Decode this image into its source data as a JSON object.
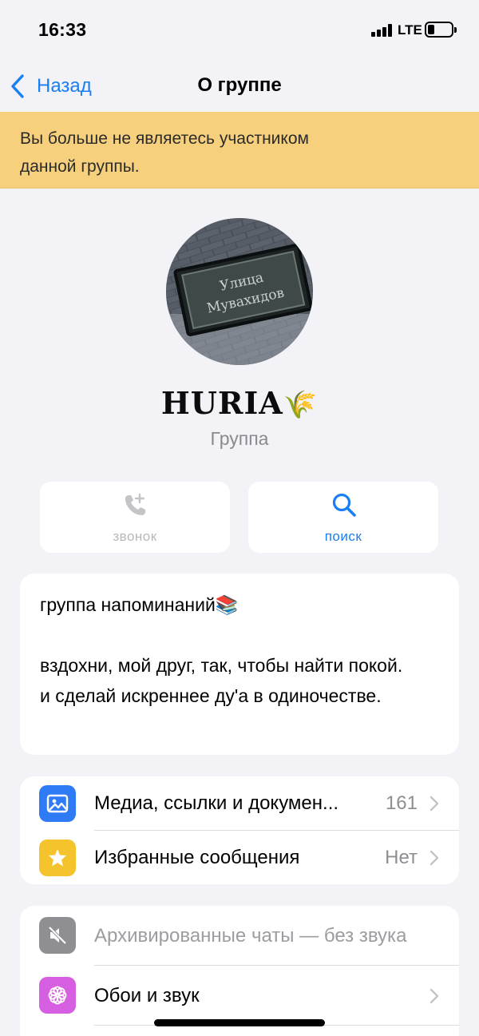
{
  "status_bar": {
    "time": "16:33",
    "network": "LTE",
    "battery_level": 0.28
  },
  "nav": {
    "back_label": "Назад",
    "title": "О группе"
  },
  "banner": {
    "text": "Вы больше не являетесь участником\nданной группы."
  },
  "profile": {
    "avatar_sign_line1": "Улица",
    "avatar_sign_line2": "Мувахидов",
    "name": "HURIA",
    "name_emoji": "🌾",
    "subtitle": "Группа"
  },
  "actions": {
    "call_label": "звонок",
    "search_label": "поиск"
  },
  "about": {
    "text": "группа напоминаний📚\n\nвздохни, мой друг, так, чтобы найти покой.\nи сделай искреннее ду'а в одиночестве."
  },
  "media_section": {
    "items": [
      {
        "label": "Медиа, ссылки и докумен...",
        "value": "161",
        "icon": "photo-icon",
        "color": "#2f7bf5"
      },
      {
        "label": "Избранные сообщения",
        "value": "Нет",
        "icon": "star-icon",
        "color": "#f5c32c"
      }
    ]
  },
  "settings_section": {
    "items": [
      {
        "label": "Архивированные чаты — без звука",
        "icon": "muted-speaker-icon",
        "color": "#8e8e93"
      },
      {
        "label": "Обои и звук",
        "icon": "flower-icon",
        "color": "#d65ee0"
      }
    ]
  },
  "colors": {
    "accent": "#1a7ef5",
    "banner": "#f6d07c",
    "background": "#f2f2f7"
  }
}
